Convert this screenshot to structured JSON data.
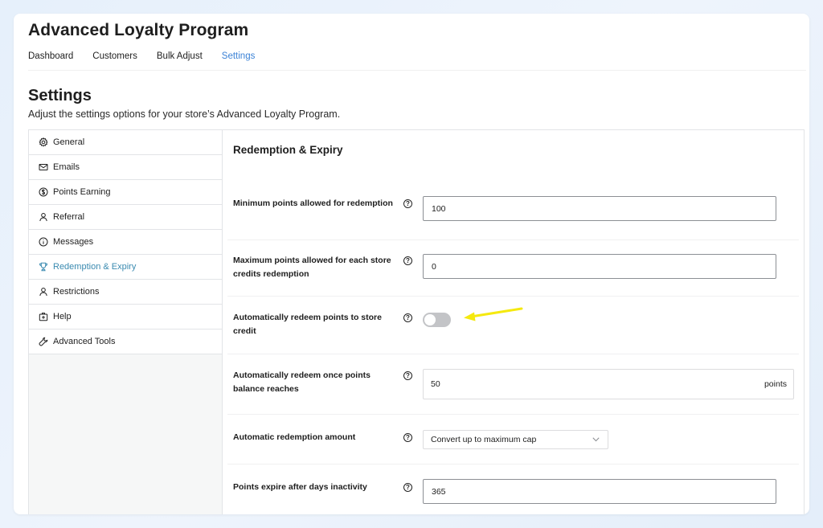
{
  "app": {
    "title": "Advanced Loyalty Program"
  },
  "tabs": [
    {
      "label": "Dashboard"
    },
    {
      "label": "Customers"
    },
    {
      "label": "Bulk Adjust"
    },
    {
      "label": "Settings"
    }
  ],
  "page": {
    "title": "Settings",
    "description": "Adjust the settings options for your store’s Advanced Loyalty Program."
  },
  "sidebar": {
    "items": [
      {
        "label": "General",
        "icon": "gear-icon"
      },
      {
        "label": "Emails",
        "icon": "envelope-icon"
      },
      {
        "label": "Points Earning",
        "icon": "dollar-circle-icon"
      },
      {
        "label": "Referral",
        "icon": "person-icon"
      },
      {
        "label": "Messages",
        "icon": "info-icon"
      },
      {
        "label": "Redemption & Expiry",
        "icon": "trophy-icon"
      },
      {
        "label": "Restrictions",
        "icon": "person-icon"
      },
      {
        "label": "Help",
        "icon": "help-box-icon"
      },
      {
        "label": "Advanced Tools",
        "icon": "wrench-icon"
      }
    ]
  },
  "main": {
    "section_title": "Redemption & Expiry",
    "help_glyph": "?",
    "fields": {
      "min_points": {
        "label": "Minimum points allowed for redemption",
        "value": "100"
      },
      "max_points": {
        "label": "Maximum points allowed for each store credits redemption",
        "value": "0"
      },
      "auto_redeem": {
        "label": "Automatically redeem points to store credit",
        "enabled": false
      },
      "auto_threshold": {
        "label": "Automatically redeem once points balance reaches",
        "value": "50",
        "suffix": "points"
      },
      "auto_amount": {
        "label": "Automatic redemption amount",
        "selected": "Convert up to maximum cap"
      },
      "expiry_days": {
        "label": "Points expire after days inactivity",
        "value": "365"
      }
    }
  },
  "colors": {
    "accent": "#3b82d6",
    "active_nav": "#3a8ab0",
    "arrow": "#f5e90f",
    "toggle_off": "#c3c4c7"
  }
}
